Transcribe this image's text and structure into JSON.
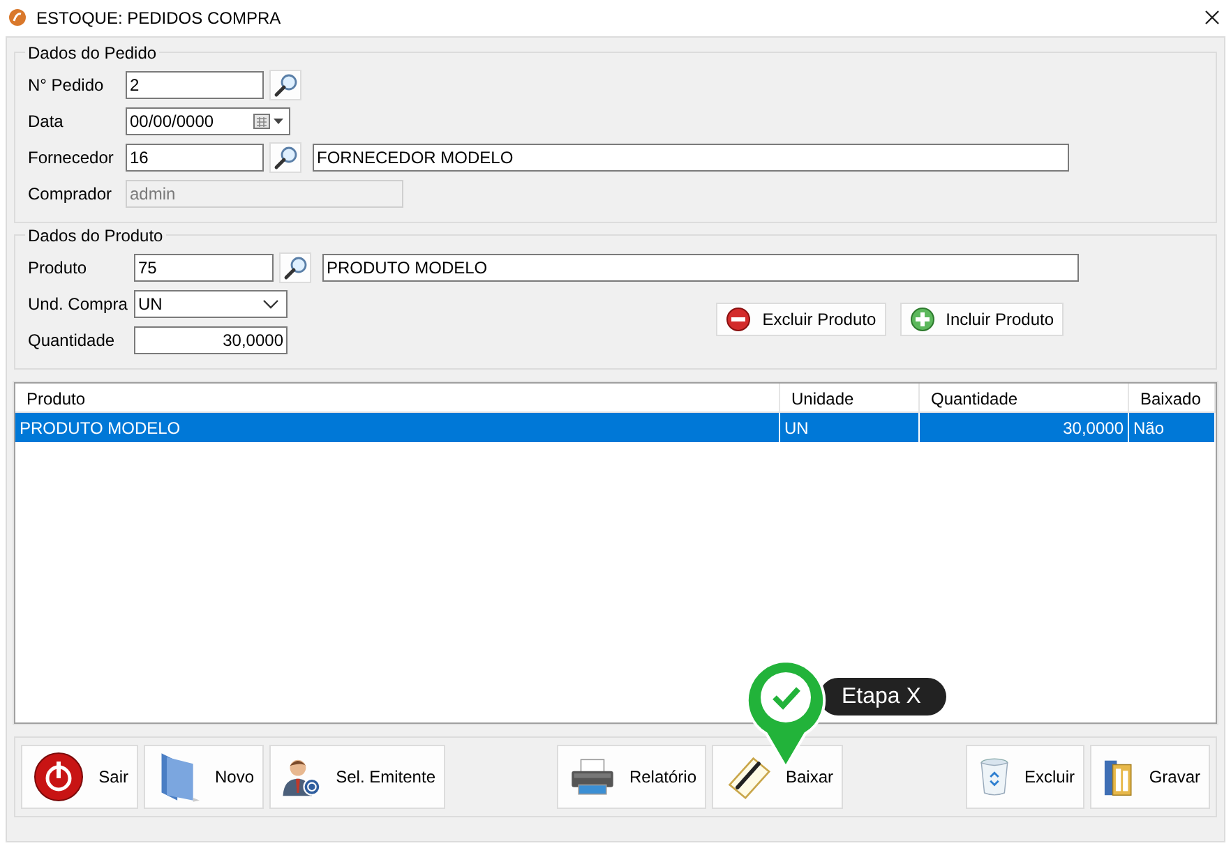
{
  "window": {
    "title": "ESTOQUE: PEDIDOS COMPRA"
  },
  "order_group": {
    "title": "Dados do Pedido",
    "fields": [
      {
        "kind": "lookup",
        "label": "N° Pedido",
        "value": "2"
      },
      {
        "kind": "date",
        "label": "Data",
        "value": "00/00/0000"
      },
      {
        "kind": "lookup",
        "label": "Fornecedor",
        "value": "16",
        "description": "FORNECEDOR MODELO"
      },
      {
        "kind": "text",
        "label": "Comprador",
        "value": "admin",
        "disabled": true
      }
    ]
  },
  "product_group": {
    "title": "Dados do Produto",
    "fields": [
      {
        "kind": "lookup",
        "label": "Produto",
        "value": "75",
        "description": "PRODUTO MODELO"
      },
      {
        "kind": "select",
        "label": "Und. Compra",
        "value": "UN"
      },
      {
        "kind": "number",
        "label": "Quantidade",
        "value": "30,0000"
      }
    ],
    "buttons": [
      {
        "kind": "remove",
        "label": "Excluir Produto"
      },
      {
        "kind": "add",
        "label": "Incluir Produto"
      }
    ]
  },
  "items_table": {
    "columns": [
      "Produto",
      "Unidade",
      "Quantidade",
      "Baixado"
    ],
    "rows": [
      {
        "cells": [
          "PRODUTO MODELO",
          "UN",
          "30,0000",
          "Não"
        ],
        "selected": true
      }
    ]
  },
  "toolbar": {
    "groups": [
      [
        {
          "kind": "exit",
          "label": "Sair"
        },
        {
          "kind": "new",
          "label": "Novo"
        },
        {
          "kind": "user",
          "label": "Sel. Emitente"
        }
      ],
      [
        {
          "kind": "print",
          "label": "Relatório"
        },
        {
          "kind": "write",
          "label": "Baixar"
        }
      ],
      [
        {
          "kind": "delete",
          "label": "Excluir"
        },
        {
          "kind": "save",
          "label": "Gravar"
        }
      ]
    ]
  },
  "callout": {
    "label": "Etapa X"
  }
}
